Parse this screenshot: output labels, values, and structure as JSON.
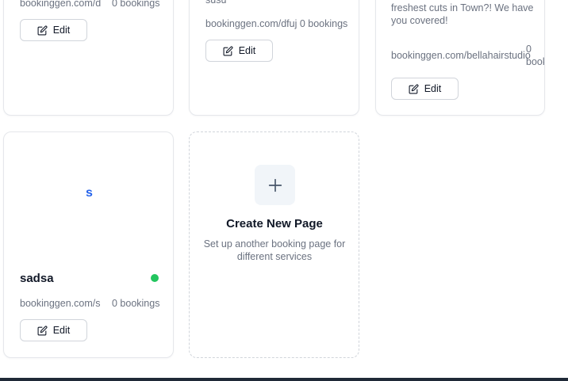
{
  "cards_top": [
    {
      "url": "bookinggen.com/d",
      "bookings": "0 bookings",
      "edit_label": "Edit"
    },
    {
      "name": "susu",
      "url_bookings": "bookinggen.com/dfuj 0 bookings",
      "edit_label": "Edit"
    },
    {
      "description": "Looking for the fanciest and the freshest cuts in Town?! We have you covered!",
      "url": "bookinggen.com/bellahairstudio",
      "bookings_count": "0",
      "bookings_word": "book",
      "edit_label": "Edit"
    }
  ],
  "page_card": {
    "initial": "s",
    "initial_color": "#2563eb",
    "name": "sadsa",
    "status_color": "#22c55e",
    "url": "bookinggen.com/s",
    "bookings": "0 bookings",
    "edit_label": "Edit"
  },
  "create_card": {
    "title": "Create New Page",
    "subtitle_line1": "Set up another booking page for",
    "subtitle_line2": "different services"
  },
  "icons": {
    "edit": "edit-icon",
    "plus": "plus-icon"
  }
}
